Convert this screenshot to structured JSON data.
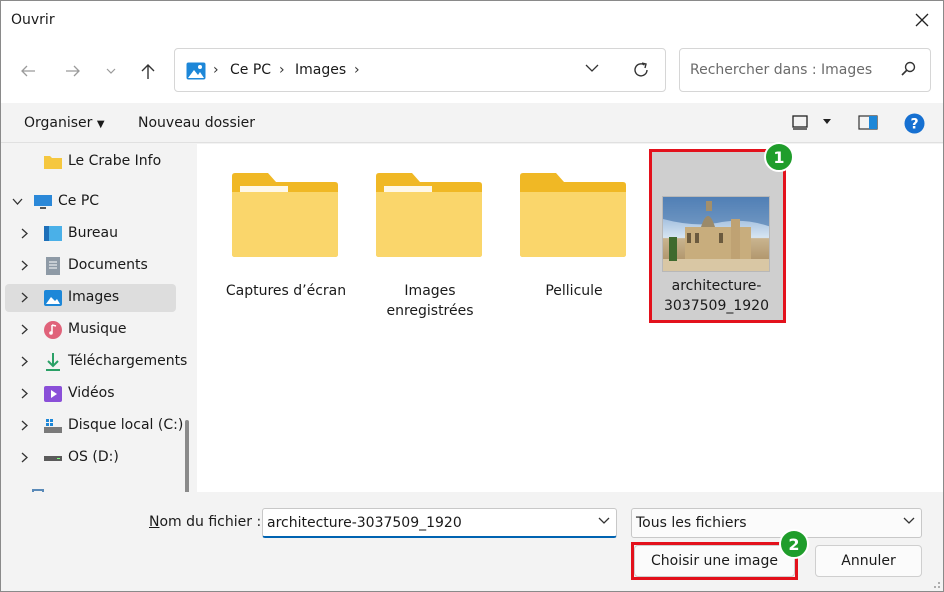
{
  "window": {
    "title": "Ouvrir"
  },
  "nav": {
    "breadcrumbs": [
      "Ce PC",
      "Images"
    ],
    "search_placeholder": "Rechercher dans : Images"
  },
  "toolbar": {
    "organize_label": "Organiser",
    "new_folder_label": "Nouveau dossier"
  },
  "sidebar": {
    "quick_access": {
      "label": "Le Crabe Info"
    },
    "this_pc": {
      "label": "Ce PC"
    },
    "items": [
      {
        "label": "Bureau",
        "icon": "desktop-icon"
      },
      {
        "label": "Documents",
        "icon": "documents-icon"
      },
      {
        "label": "Images",
        "icon": "pictures-icon",
        "selected": true
      },
      {
        "label": "Musique",
        "icon": "music-icon"
      },
      {
        "label": "Téléchargements",
        "icon": "download-icon"
      },
      {
        "label": "Vidéos",
        "icon": "videos-icon"
      },
      {
        "label": "Disque local (C:)",
        "icon": "local-disk-icon"
      },
      {
        "label": "OS (D:)",
        "icon": "drive-icon"
      }
    ]
  },
  "content": {
    "items": [
      {
        "name": "Captures d’écran",
        "type": "folder"
      },
      {
        "name": "Images enregistrées",
        "type": "folder"
      },
      {
        "name": "Pellicule",
        "type": "folder"
      },
      {
        "name": "architecture-3037509_1920",
        "type": "image",
        "selected": true
      }
    ]
  },
  "annotations": {
    "badge1": "1",
    "badge2": "2",
    "highlight_color": "#e3111c",
    "badge_color": "#1f9d2b"
  },
  "footer": {
    "filename_label_underlined": "N",
    "filename_label_rest": "om du fichier :",
    "filename_value": "architecture-3037509_1920",
    "filter_value": "Tous les fichiers",
    "open_button": "Choisir une image",
    "cancel_button": "Annuler"
  },
  "colors": {
    "accent": "#0063b1",
    "help": "#1670d1",
    "folder": "#f5c73f"
  }
}
